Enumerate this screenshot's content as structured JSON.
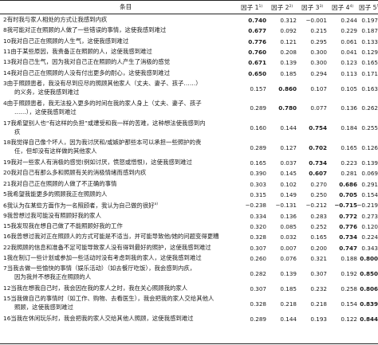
{
  "header": {
    "item_label": "条目",
    "factors": [
      {
        "label": "因子 1",
        "sup": "1)"
      },
      {
        "label": "因子 2",
        "sup": "2)"
      },
      {
        "label": "因子 3",
        "sup": "3)"
      },
      {
        "label": "因子 4",
        "sup": "4)"
      },
      {
        "label": "因子 5",
        "sup": "5)"
      }
    ]
  },
  "rows": [
    {
      "lines": [
        "2有时我与家人相处的方式让我感到内疚"
      ],
      "values": [
        "0.740",
        "0.312",
        "−0.001",
        "0.244",
        "0.197"
      ],
      "bold": 0
    },
    {
      "lines": [
        "8我可能对正在照顾的人做了一些错误的事情，这使我感到难过"
      ],
      "values": [
        "0.677",
        "0.092",
        "0.215",
        "0.229",
        "0.187"
      ],
      "bold": 0
    },
    {
      "lines": [
        "10我对自己正在照顾的人生气，这使我感到难过"
      ],
      "values": [
        "0.776",
        "0.121",
        "0.295",
        "0.061",
        "0.133"
      ],
      "bold": 0
    },
    {
      "lines": [
        "11由于某些原因，我责备正在照顾的人，这使我感到难过"
      ],
      "values": [
        "0.760",
        "0.208",
        "0.300",
        "0.041",
        "0.129"
      ],
      "bold": 0
    },
    {
      "lines": [
        "13我对自己生气，因为我对自己正在照顾的人产生了消极的感觉"
      ],
      "values": [
        "0.671",
        "0.139",
        "0.300",
        "0.123",
        "0.165"
      ],
      "bold": 0
    },
    {
      "lines": [
        "14我对自己正在照顾的人没有付出更多的耐心，这使我感到难过"
      ],
      "values": [
        "0.650",
        "0.185",
        "0.294",
        "0.113",
        "0.171"
      ],
      "bold": 0
    },
    {
      "lines": [
        "3由于照顾患者，我没有尽到应尽的照顾其他家人（丈夫、妻子、孩子……）",
        "的义务，这使我感到难过"
      ],
      "values": [
        "0.157",
        "0.860",
        "0.107",
        "0.105",
        "0.163"
      ],
      "bold": 1
    },
    {
      "lines": [
        "4由于照顾患者，我无法投入更多的时间在我的家人身上（丈夫、妻子、孩子",
        "……），这使我感到难过"
      ],
      "values": [
        "0.289",
        "0.780",
        "0.077",
        "0.136",
        "0.262"
      ],
      "bold": 1
    },
    {
      "lines": [
        "17我希望别人也“有这样的负担”或遭受和我一样的苦难，这种想法使我感到内",
        "疚"
      ],
      "values": [
        "0.160",
        "0.144",
        "0.754",
        "0.184",
        "0.255"
      ],
      "bold": 2
    },
    {
      "lines": [
        "18我觉得自己像个坏人，因为我讨厌和/或嫉妒那些本可以承担一些照护的责",
        "任，但却没有这样做的其他家人"
      ],
      "values": [
        "0.289",
        "0.127",
        "0.702",
        "0.165",
        "0.126"
      ],
      "bold": 2
    },
    {
      "lines": [
        "19我对一些家人有消极的感觉(例如讨厌，愤怒或憎恨)，这使我感到难过"
      ],
      "values": [
        "0.165",
        "0.037",
        "0.734",
        "0.223",
        "0.139"
      ],
      "bold": 2
    },
    {
      "lines": [
        "20我对自己有那么多和照顾有关的消极情绪而感到内疚"
      ],
      "values": [
        "0.390",
        "0.145",
        "0.607",
        "0.281",
        "0.069"
      ],
      "bold": 2
    },
    {
      "lines": [
        "21我对自己正在照顾的人做了不正确的事情"
      ],
      "values": [
        "0.303",
        "0.102",
        "0.270",
        "0.686",
        "0.291"
      ],
      "bold": 3
    },
    {
      "lines": [
        "5我希望我能更多的照顾我正在照顾的人"
      ],
      "values": [
        "0.315",
        "0.149",
        "0.250",
        "0.705",
        "0.154"
      ],
      "bold": 3
    },
    {
      "lines": [
        "6我认为在某些方面作为一名照顾者，我认为自己做的很好",
        "a)"
      ],
      "values": [
        "−0.238",
        "−0.131",
        "−0.212",
        "−0.715",
        "−0.219"
      ],
      "bold": 3
    },
    {
      "lines": [
        "9我曾想过我可能没有照顾好我的家人"
      ],
      "values": [
        "0.334",
        "0.136",
        "0.283",
        "0.772",
        "0.273"
      ],
      "bold": 3
    },
    {
      "lines": [
        "15我发现我在想自己做了不能照顾好我的工作"
      ],
      "values": [
        "0.320",
        "0.085",
        "0.252",
        "0.776",
        "0.120"
      ],
      "bold": 3
    },
    {
      "lines": [
        "16我曾想过我对正在照顾人的方式可能是不适当，并可能导致他/她的问题变得更糟"
      ],
      "values": [
        "0.328",
        "0.032",
        "0.165",
        "0.734",
        "0.224"
      ],
      "bold": 3
    },
    {
      "lines": [
        "22我照顾的信息和准备不足可能导致家人没有得到最好的照护，这使我感到难过"
      ],
      "values": [
        "0.307",
        "0.007",
        "0.200",
        "0.747",
        "0.343"
      ],
      "bold": 3
    },
    {
      "lines": [
        "1我在制订一些计划或参加一些活动时没有考虑到我的家人，这使我感到难过"
      ],
      "values": [
        "0.260",
        "0.076",
        "0.321",
        "0.188",
        "0.800"
      ],
      "bold": 4
    },
    {
      "lines": [
        "7当我去做一些愉快的事情（娱乐活动）（如去餐厅吃饭），我会感到内疚，",
        "因为我并不想我正在照顾的人"
      ],
      "values": [
        "0.282",
        "0.139",
        "0.307",
        "0.192",
        "0.850"
      ],
      "bold": 4
    },
    {
      "lines": [
        "12当我在想我自己时，我会因在我的家人之时，我在关心照顾我的家人"
      ],
      "values": [
        "0.307",
        "0.185",
        "0.232",
        "0.258",
        "0.806"
      ],
      "bold": 4
    },
    {
      "lines": [
        "15当我做自己的事情时（如工作、购物、去看医生），我会把我的家人交给其他人",
        "照顾，这使我感到难过"
      ],
      "values": [
        "0.328",
        "0.218",
        "0.218",
        "0.154",
        "0.839"
      ],
      "bold": 4
    },
    {
      "lines": [
        "16当我在休闲玩乐时，我会把我的家人交给其他人照顾，这使我感到难过"
      ],
      "values": [
        "0.289",
        "0.144",
        "0.193",
        "0.122",
        "0.844"
      ],
      "bold": 4
    }
  ]
}
